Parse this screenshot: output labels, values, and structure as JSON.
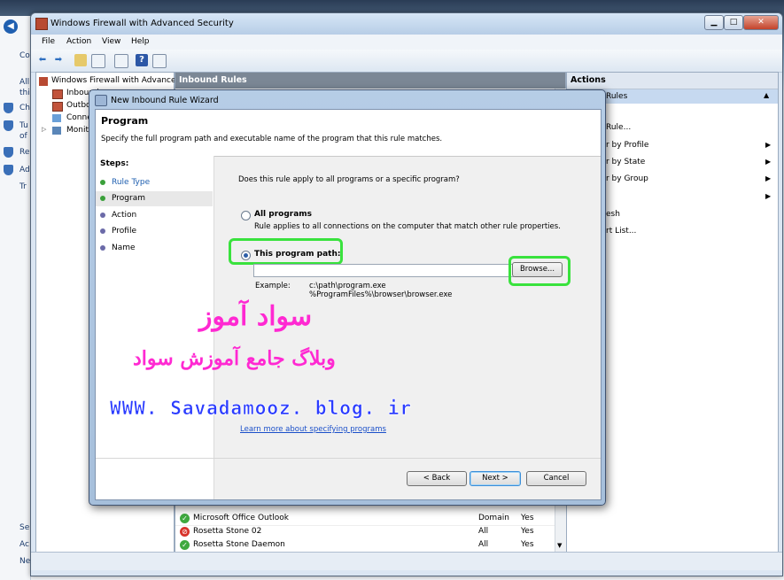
{
  "desktop": {
    "left_labels": [
      "Co",
      "All",
      "thi",
      "Ch",
      "Tu",
      "of",
      "Re",
      "Ad",
      "Tr",
      "Se",
      "Ac",
      "Ne"
    ]
  },
  "mmc": {
    "title": "Windows Firewall with Advanced Security",
    "menu": [
      "File",
      "Action",
      "View",
      "Help"
    ],
    "tree": {
      "root": "Windows Firewall with Advance",
      "items": [
        "Inbound",
        "Outbo",
        "Conne",
        "Monit"
      ]
    },
    "middle": {
      "header": "Inbound Rules",
      "rows": [
        {
          "name": "Microsoft Office Outlook",
          "profile": "Domain",
          "enabled": "Yes",
          "status": "allow"
        },
        {
          "name": "Rosetta Stone 02",
          "profile": "All",
          "enabled": "Yes",
          "status": "block"
        },
        {
          "name": "Rosetta Stone Daemon",
          "profile": "All",
          "enabled": "Yes",
          "status": "allow"
        }
      ]
    },
    "actions": {
      "header": "Actions",
      "section": "Rules",
      "items": [
        "Rule...",
        "r by Profile",
        "r by State",
        "r by Group",
        "",
        "esh",
        "rt List..."
      ]
    }
  },
  "wizard": {
    "title": "New Inbound Rule Wizard",
    "heading": "Program",
    "subtitle": "Specify the full program path and executable name of the program that this rule matches.",
    "steps_title": "Steps:",
    "steps": [
      {
        "label": "Rule Type",
        "state": "done"
      },
      {
        "label": "Program",
        "state": "active"
      },
      {
        "label": "Action",
        "state": "pending"
      },
      {
        "label": "Profile",
        "state": "pending"
      },
      {
        "label": "Name",
        "state": "pending"
      }
    ],
    "question": "Does this rule apply to all programs or a specific program?",
    "all_programs_label": "All programs",
    "all_programs_desc": "Rule applies to all connections on the computer that match other rule properties.",
    "this_program_label": "This program path:",
    "program_path_value": "",
    "browse_label": "Browse...",
    "example_label": "Example:",
    "example_line1": "c:\\path\\program.exe",
    "example_line2": "%ProgramFiles%\\browser\\browser.exe",
    "learn_more": "Learn more about specifying programs",
    "back_label": "< Back",
    "next_label": "Next >",
    "cancel_label": "Cancel",
    "selected_option": "this_program"
  },
  "watermark": {
    "line1": "سواد آموز",
    "line2": "وبلاگ جامع آموزش سواد",
    "url": "WWW. Savadamooz. blog. ir"
  },
  "colors": {
    "highlight_green": "#39e23d",
    "watermark_pink": "#ff29d2",
    "watermark_blue": "#2b3cff"
  }
}
